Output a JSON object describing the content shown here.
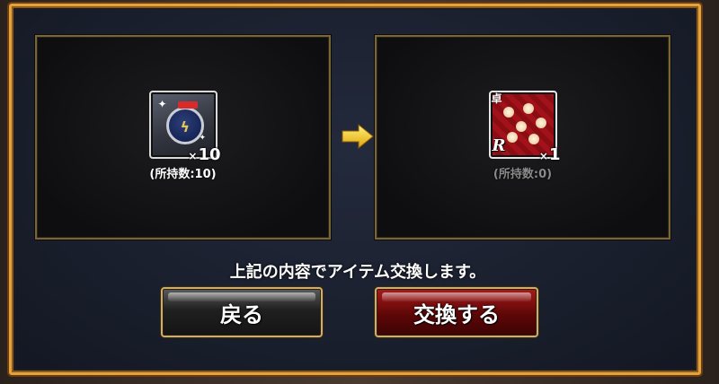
{
  "dialog": {
    "message": "上記の内容でアイテム交換します。"
  },
  "source_item": {
    "icon": "medal-ticket-icon",
    "quantity_prefix": "×",
    "quantity": "10",
    "owned_label": "(所持数:10)"
  },
  "target_item": {
    "icon": "red-floral-card-icon",
    "rarity_badge": "R",
    "category_badge": "卓",
    "quantity_prefix": "×",
    "quantity": "1",
    "owned_label": "(所持数:0)"
  },
  "buttons": {
    "back_label": "戻る",
    "exchange_label": "交換する"
  },
  "colors": {
    "frame_gold": "#e3a23a",
    "arrow_yellow": "#f3c21e",
    "exchange_red": "#7a0b0b"
  }
}
